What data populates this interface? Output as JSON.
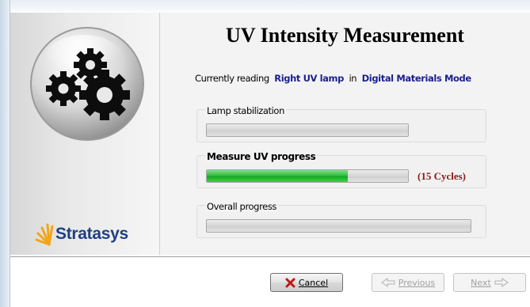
{
  "wizard": {
    "title": "UV Intensity Measurement",
    "reading_prefix": "Currently reading",
    "reading_target": "Right UV lamp",
    "reading_in": "in",
    "reading_mode": "Digital Materials Mode"
  },
  "groups": {
    "stabilization": {
      "label": "Lamp stabilization",
      "progress": 0
    },
    "measure": {
      "label": "Measure UV progress",
      "progress": 0.7,
      "cycles": "(15 Cycles)"
    },
    "overall": {
      "label": "Overall progress",
      "progress": 0
    }
  },
  "buttons": {
    "cancel": "Cancel",
    "previous": "Previous",
    "next": "Next"
  },
  "brand": {
    "logo_text": "Stratasys"
  },
  "icons": {
    "gears": "gears-icon",
    "cancel": "x-icon",
    "previous": "left-arrow-icon",
    "next": "right-arrow-icon"
  },
  "colors": {
    "progress_green": "#22b532",
    "highlight_text": "#1a1f8f",
    "cycles_text": "#8b1a1a",
    "logo_blue": "#1f3f82",
    "logo_orange": "#f2a516"
  }
}
